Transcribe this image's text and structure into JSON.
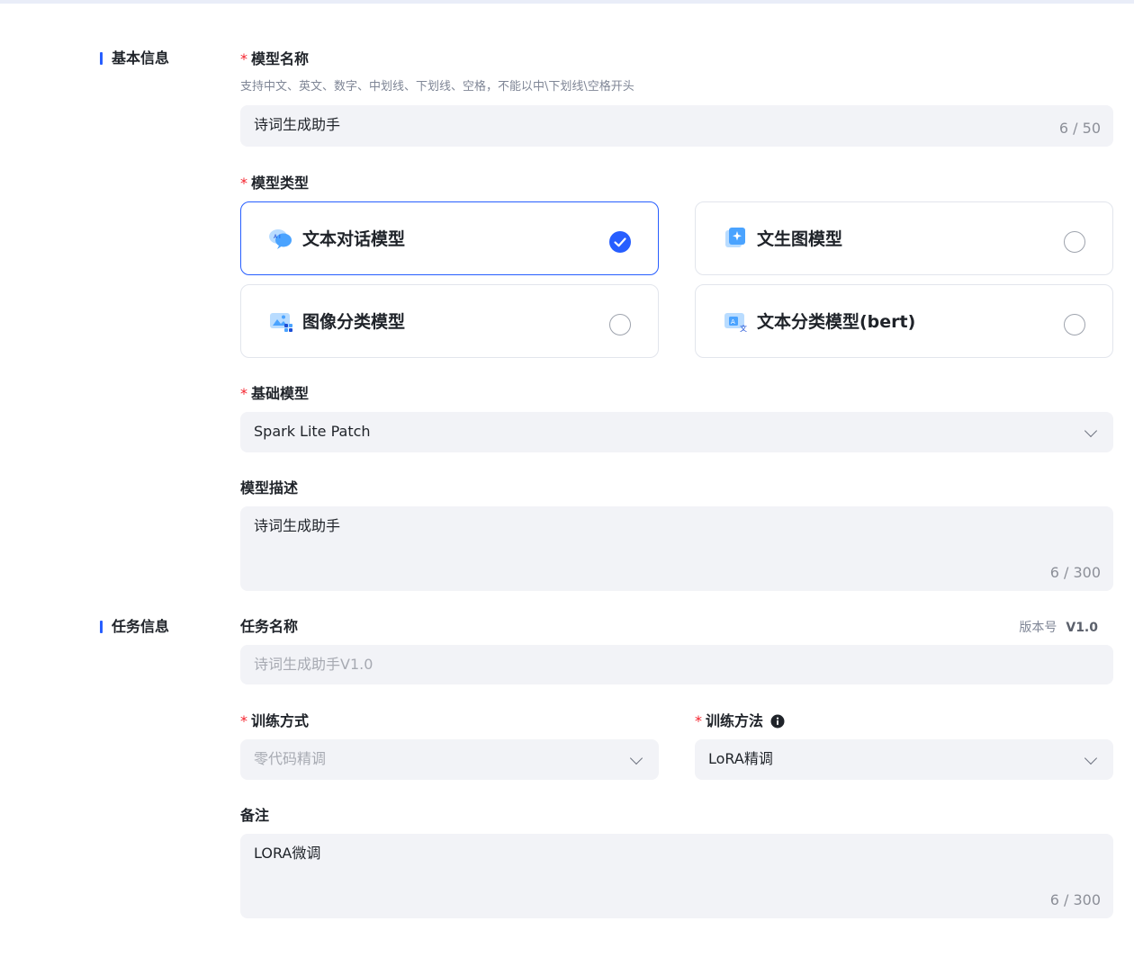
{
  "sections": {
    "basic": "基本信息",
    "task": "任务信息"
  },
  "model_name": {
    "label": "模型名称",
    "hint": "支持中文、英文、数字、中划线、下划线、空格，不能以中\\下划线\\空格开头",
    "value": "诗词生成助手",
    "counter": "6 / 50"
  },
  "model_type": {
    "label": "模型类型",
    "options": [
      {
        "label": "文本对话模型",
        "selected": true,
        "icon": "chat-ai-icon"
      },
      {
        "label": "文生图模型",
        "selected": false,
        "icon": "text-to-image-icon"
      },
      {
        "label": "图像分类模型",
        "selected": false,
        "icon": "image-classify-icon"
      },
      {
        "label": "文本分类模型(bert)",
        "selected": false,
        "icon": "text-classify-icon"
      }
    ]
  },
  "base_model": {
    "label": "基础模型",
    "value": "Spark Lite Patch"
  },
  "description": {
    "label": "模型描述",
    "value": "诗词生成助手",
    "counter": "6 / 300"
  },
  "task_name": {
    "label": "任务名称",
    "version_label": "版本号",
    "version_value": "V1.0",
    "placeholder": "诗词生成助手V1.0"
  },
  "training_mode": {
    "label": "训练方式",
    "value": "零代码精调"
  },
  "training_method": {
    "label": "训练方法",
    "value": "LoRA精调"
  },
  "remark": {
    "label": "备注",
    "value": "LORA微调",
    "counter": "6 / 300"
  },
  "colors": {
    "accent": "#275eff",
    "required": "#f5222d",
    "field_bg": "#f2f3f7"
  }
}
